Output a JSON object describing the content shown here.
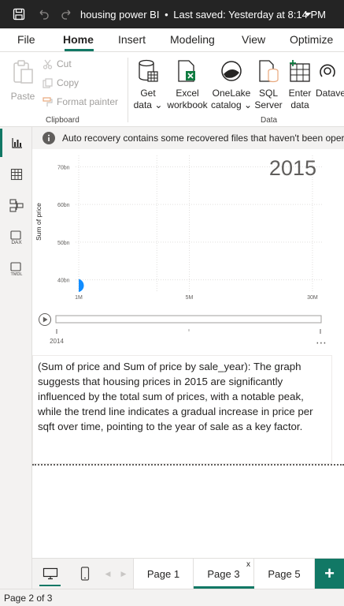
{
  "titlebar": {
    "file_name": "housing power BI",
    "separator": "•",
    "last_saved": "Last saved: Yesterday at 8:14 PM"
  },
  "menu": {
    "items": [
      "File",
      "Home",
      "Insert",
      "Modeling",
      "View",
      "Optimize"
    ],
    "active": "Home"
  },
  "ribbon": {
    "clipboard": {
      "paste_label": "Paste",
      "cut_label": "Cut",
      "copy_label": "Copy",
      "format_painter_label": "Format painter",
      "group_label": "Clipboard"
    },
    "data": {
      "get_data_line1": "Get",
      "get_data_line2": "data",
      "excel_line1": "Excel",
      "excel_line2": "workbook",
      "onelake_line1": "OneLake",
      "onelake_line2": "catalog",
      "sql_line1": "SQL",
      "sql_line2": "Server",
      "enter_line1": "Enter",
      "enter_line2": "data",
      "dataverse_line1": "Datave",
      "group_label": "Data"
    }
  },
  "infobar": {
    "message": "Auto recovery contains some recovered files that haven't been oper"
  },
  "chart_data": {
    "type": "scatter",
    "title": "2015",
    "ylabel": "Sum of price",
    "xlabel": "",
    "x_scale": "log",
    "x_ticks": [
      "1M",
      "5M",
      "30M"
    ],
    "x_tick_values": [
      1000000,
      5000000,
      30000000
    ],
    "y_ticks": [
      "40bn",
      "50bn",
      "60bn",
      "70bn"
    ],
    "y_tick_values": [
      40,
      50,
      60,
      70
    ],
    "ylim": [
      37,
      73
    ],
    "grid": true,
    "series": [
      {
        "points": [
          {
            "x": 1000000,
            "y": 38.5
          }
        ]
      }
    ],
    "point_color": "#118DFF",
    "play_axis": {
      "start_label": "2014"
    }
  },
  "narrative": {
    "text": " (Sum of price and Sum of price by sale_year): The graph suggests that housing prices in 2015 are significantly influenced by the total sum of prices, with a notable peak, while the trend line indicates a gradual increase in price per sqft over time, pointing to the year of sale as a key factor."
  },
  "pages": {
    "tabs": [
      "Page 1",
      "Page 3",
      "Page 5"
    ],
    "active": "Page 3",
    "add_label": "+"
  },
  "status": {
    "page_indicator": "Page 2 of 3"
  },
  "colors": {
    "accent": "#117865",
    "titlebar_bg": "#242424",
    "point": "#118DFF"
  }
}
